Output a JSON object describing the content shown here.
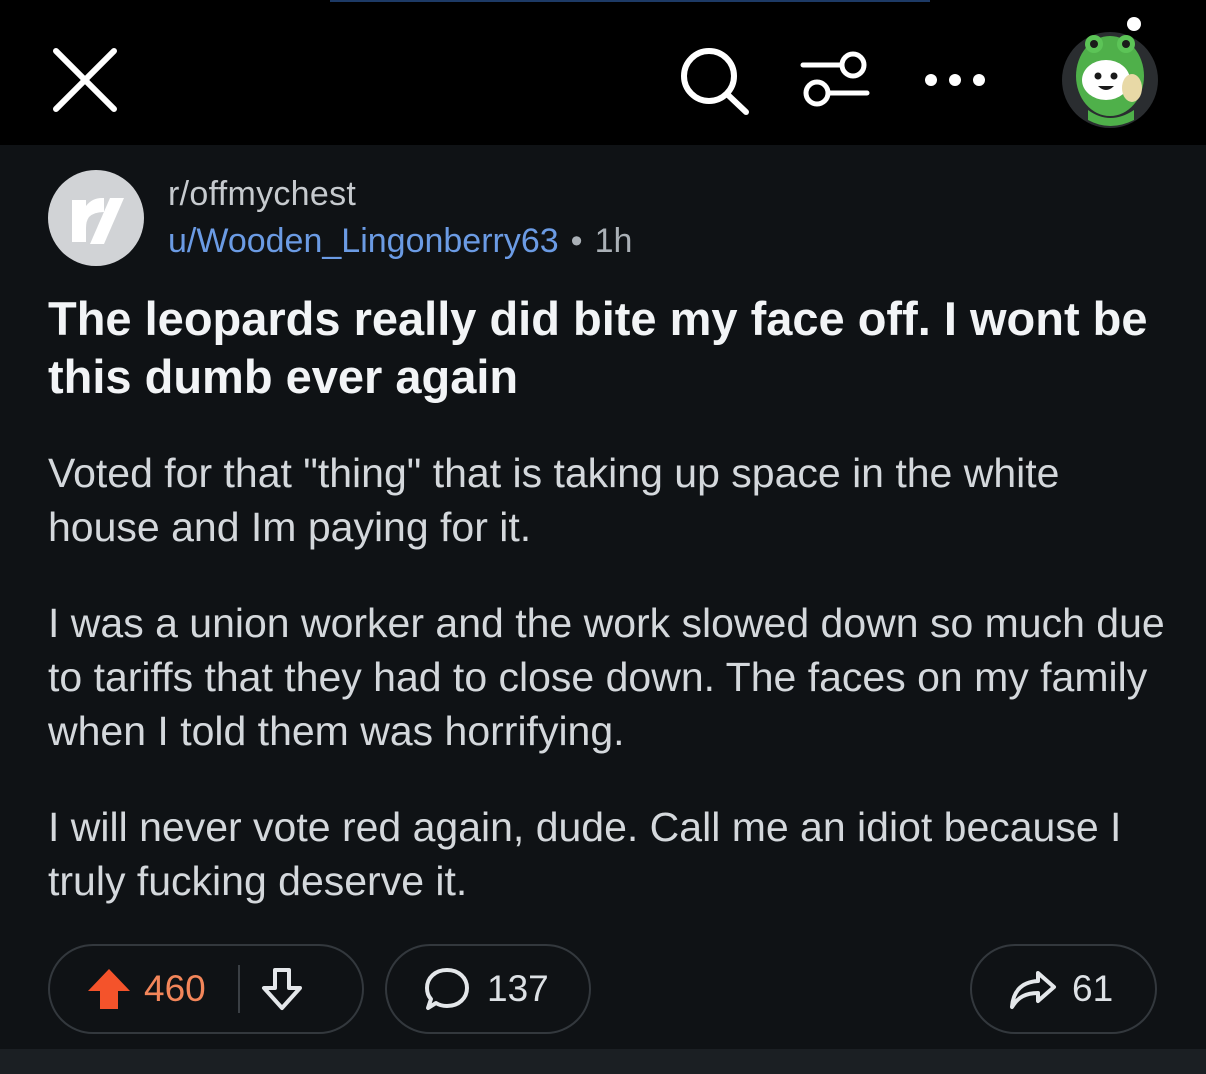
{
  "topbar": {
    "icons": [
      "close-icon",
      "search-icon",
      "filter-icon",
      "more-icon",
      "avatar-icon"
    ]
  },
  "post": {
    "subreddit": "r/offmychest",
    "author": "u/Wooden_Lingonberry63",
    "separator": "•",
    "age": "1h",
    "title": "The leopards really did bite my face off. I wont be this dumb ever again",
    "paragraphs": [
      "Voted for that \"thing\" that is taking up space in the white house and Im paying for it.",
      "I was a union worker and the work slowed down so much due to tariffs that they had to close down. The faces on my family when I told them was horrifying.",
      "I will never vote red again, dude. Call me an idiot because I truly fucking deserve it."
    ]
  },
  "actions": {
    "upvotes": "460",
    "comments": "137",
    "shares": "61"
  },
  "colors": {
    "background": "#0f1215",
    "topbar": "#000000",
    "author_link": "#6b9be4",
    "upvote_accent": "#f4532b",
    "upvote_count": "#f3865a"
  }
}
